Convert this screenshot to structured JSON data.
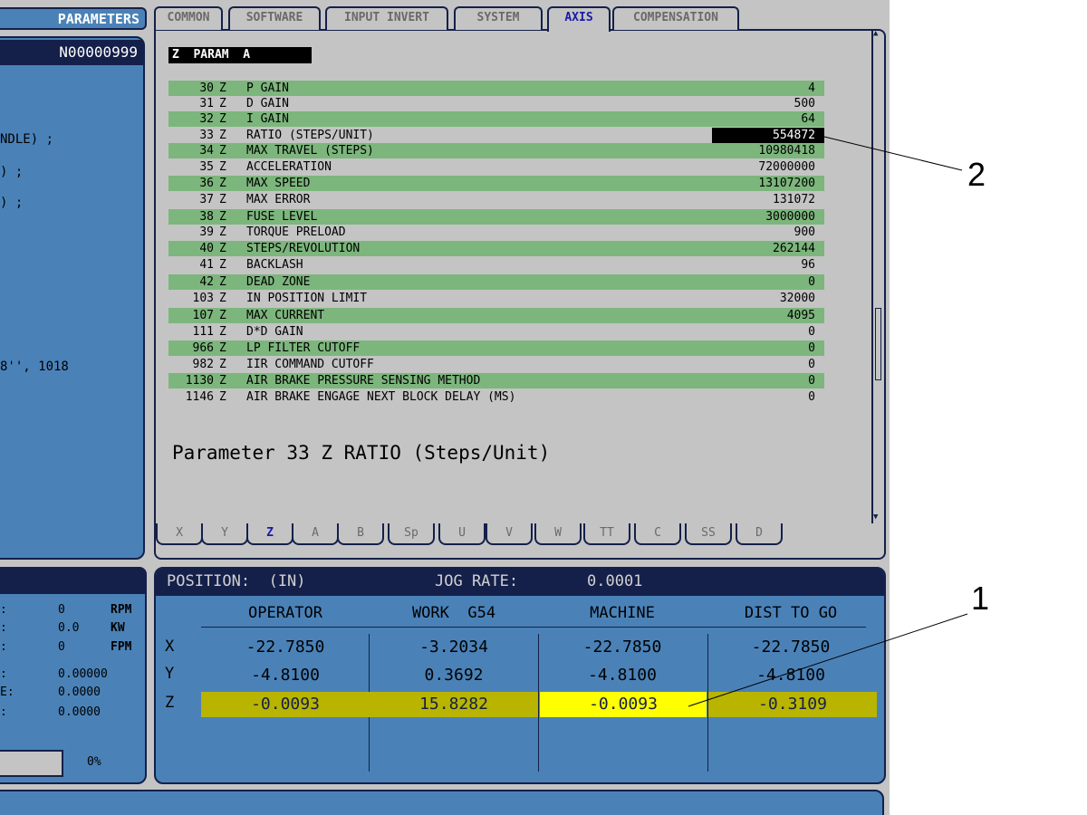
{
  "left_panel": {
    "header": "PARAMETERS",
    "program_number": "N00000999",
    "code_lines": [
      "NDLE) ;",
      ") ;",
      ") ;",
      "8'', 1018"
    ]
  },
  "top_tabs": [
    {
      "label": "COMMON",
      "active": false
    },
    {
      "label": "SOFTWARE",
      "active": false
    },
    {
      "label": "INPUT INVERT",
      "active": false
    },
    {
      "label": "SYSTEM",
      "active": false
    },
    {
      "label": "AXIS",
      "active": true
    },
    {
      "label": "COMPENSATION",
      "active": false
    }
  ],
  "param_table": {
    "title": "Z  PARAM  A",
    "rows": [
      {
        "num": "30",
        "axis": "Z",
        "name": "P GAIN",
        "value": "4"
      },
      {
        "num": "31",
        "axis": "Z",
        "name": "D GAIN",
        "value": "500"
      },
      {
        "num": "32",
        "axis": "Z",
        "name": "I GAIN",
        "value": "64"
      },
      {
        "num": "33",
        "axis": "Z",
        "name": "RATIO (STEPS/UNIT)",
        "value": "554872",
        "selected": true
      },
      {
        "num": "34",
        "axis": "Z",
        "name": "MAX TRAVEL (STEPS)",
        "value": "10980418"
      },
      {
        "num": "35",
        "axis": "Z",
        "name": "ACCELERATION",
        "value": "72000000"
      },
      {
        "num": "36",
        "axis": "Z",
        "name": "MAX SPEED",
        "value": "13107200"
      },
      {
        "num": "37",
        "axis": "Z",
        "name": "MAX ERROR",
        "value": "131072"
      },
      {
        "num": "38",
        "axis": "Z",
        "name": "FUSE LEVEL",
        "value": "3000000"
      },
      {
        "num": "39",
        "axis": "Z",
        "name": "TORQUE PRELOAD",
        "value": "900"
      },
      {
        "num": "40",
        "axis": "Z",
        "name": "STEPS/REVOLUTION",
        "value": "262144"
      },
      {
        "num": "41",
        "axis": "Z",
        "name": "BACKLASH",
        "value": "96"
      },
      {
        "num": "42",
        "axis": "Z",
        "name": "DEAD ZONE",
        "value": "0"
      },
      {
        "num": "103",
        "axis": "Z",
        "name": "IN POSITION LIMIT",
        "value": "32000"
      },
      {
        "num": "107",
        "axis": "Z",
        "name": "MAX CURRENT",
        "value": "4095"
      },
      {
        "num": "111",
        "axis": "Z",
        "name": "D*D GAIN",
        "value": "0"
      },
      {
        "num": "966",
        "axis": "Z",
        "name": "LP FILTER CUTOFF",
        "value": "0"
      },
      {
        "num": "982",
        "axis": "Z",
        "name": "IIR COMMAND CUTOFF",
        "value": "0"
      },
      {
        "num": "1130",
        "axis": "Z",
        "name": "AIR BRAKE PRESSURE SENSING METHOD",
        "value": "0"
      },
      {
        "num": "1146",
        "axis": "Z",
        "name": "AIR BRAKE ENGAGE NEXT BLOCK DELAY (MS)",
        "value": "0"
      }
    ]
  },
  "description": "Parameter 33 Z RATIO (Steps/Unit)",
  "axis_tabs": [
    {
      "label": "X",
      "active": false
    },
    {
      "label": "Y",
      "active": false
    },
    {
      "label": "Z",
      "active": true
    },
    {
      "label": "A",
      "active": false
    },
    {
      "label": "B",
      "active": false
    },
    {
      "label": "Sp",
      "active": false
    },
    {
      "label": "U",
      "active": false
    },
    {
      "label": "V",
      "active": false
    },
    {
      "label": "W",
      "active": false
    },
    {
      "label": "TT",
      "active": false
    },
    {
      "label": "C",
      "active": false
    },
    {
      "label": "SS",
      "active": false
    },
    {
      "label": "D",
      "active": false
    }
  ],
  "spindle_panel": {
    "rows": [
      {
        "prefix": ":",
        "value": "0",
        "unit": "RPM"
      },
      {
        "prefix": ":",
        "value": "0.0",
        "unit": "KW"
      },
      {
        "prefix": ":",
        "value": "0",
        "unit": "FPM"
      },
      {
        "prefix": ":",
        "value": "0.00000",
        "unit": ""
      },
      {
        "prefix": "E:",
        "value": "0.0000",
        "unit": ""
      },
      {
        "prefix": ":",
        "value": "0.0000",
        "unit": ""
      }
    ],
    "load_percent": "0%"
  },
  "position": {
    "title": "POSITION:  (IN)",
    "jog_rate_label": "JOG RATE:",
    "jog_rate_value": "0.0001",
    "columns": [
      "OPERATOR",
      "WORK  G54",
      "MACHINE",
      "DIST TO GO"
    ],
    "axes": [
      {
        "label": "X",
        "values": [
          "-22.7850",
          "-3.2034",
          "-22.7850",
          "-22.7850"
        ]
      },
      {
        "label": "Y",
        "values": [
          "-4.8100",
          "0.3692",
          "-4.8100",
          "-4.8100"
        ]
      },
      {
        "label": "Z",
        "values": [
          "-0.0093",
          "15.8282",
          "-0.0093",
          "-0.3109"
        ]
      }
    ]
  },
  "callouts": {
    "one": "1",
    "two": "2"
  }
}
